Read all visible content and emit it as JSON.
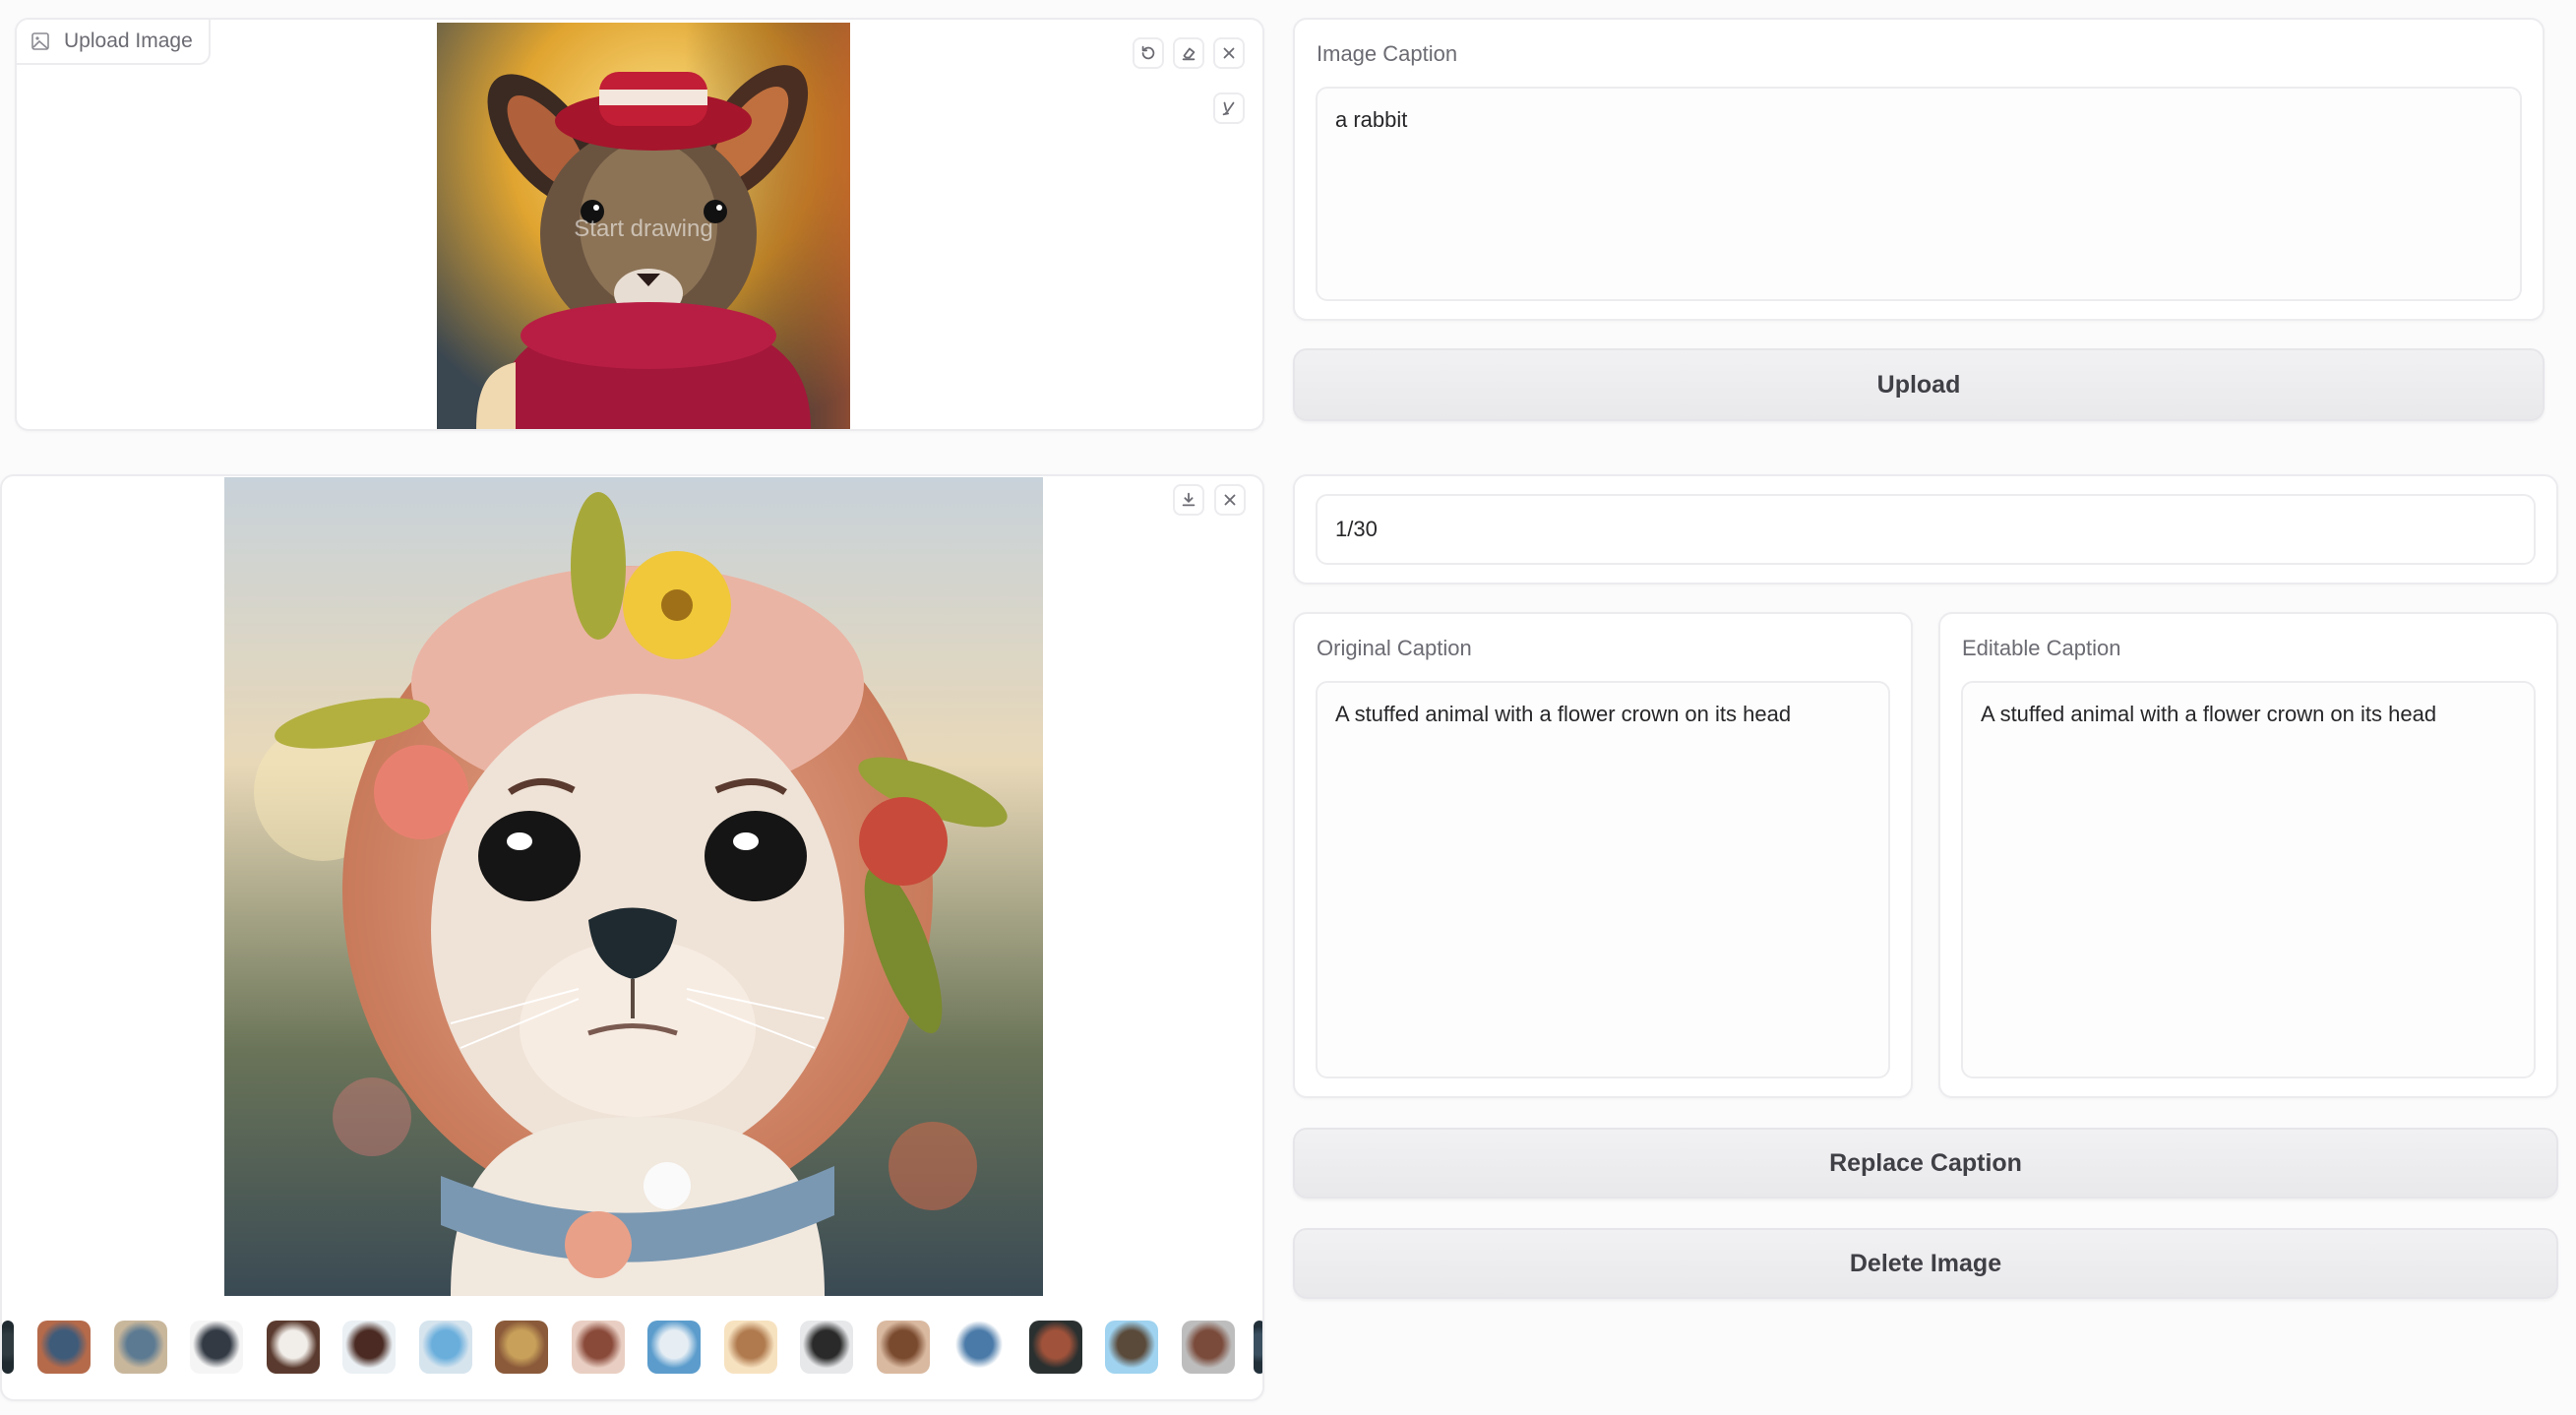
{
  "upload_panel": {
    "label": "Upload Image",
    "label_icon": "image-icon",
    "canvas_hint": "Start drawing",
    "tools": [
      "undo-icon",
      "eraser-icon",
      "close-icon",
      "brush-icon"
    ]
  },
  "gallery_panel": {
    "tools": [
      "download-icon",
      "close-icon"
    ],
    "thumbnails": [
      {
        "name": "partial-left",
        "colors": [
          "#1f2a30",
          "#2e3a40"
        ]
      },
      {
        "name": "girl-room",
        "colors": [
          "#b56a4a",
          "#3e5b7a"
        ]
      },
      {
        "name": "blonde-girl",
        "colors": [
          "#c9b79c",
          "#5c7a92"
        ]
      },
      {
        "name": "cartoon-wizard",
        "colors": [
          "#f5f5f5",
          "#333a44"
        ]
      },
      {
        "name": "santa-creature",
        "colors": [
          "#5a3a2e",
          "#f1ede8"
        ]
      },
      {
        "name": "dark-hair-kid",
        "colors": [
          "#eaf0f4",
          "#4a2a22"
        ]
      },
      {
        "name": "blue-device",
        "colors": [
          "#d6e4ee",
          "#6aaedc"
        ]
      },
      {
        "name": "hooded-girl",
        "colors": [
          "#8a5a3a",
          "#c9a05a"
        ]
      },
      {
        "name": "pink-cat",
        "colors": [
          "#e9cfc3",
          "#8a4a3a"
        ]
      },
      {
        "name": "coffee-maker",
        "colors": [
          "#5b9ccc",
          "#e6eef4"
        ]
      },
      {
        "name": "hamster",
        "colors": [
          "#f7e2c0",
          "#b07a4e"
        ]
      },
      {
        "name": "cowboy",
        "colors": [
          "#e6e8ea",
          "#2a2a2a"
        ]
      },
      {
        "name": "curly-doll",
        "colors": [
          "#d9b9a0",
          "#7a4a2e"
        ]
      },
      {
        "name": "blue-bird",
        "colors": [
          "#ffffff",
          "#4a7aa8"
        ]
      },
      {
        "name": "dark-creature",
        "colors": [
          "#2a3030",
          "#a0523a"
        ]
      },
      {
        "name": "french-press",
        "colors": [
          "#9fd3f0",
          "#5a4a3a"
        ]
      },
      {
        "name": "knit-doll",
        "colors": [
          "#bdbdbd",
          "#7a4a3a"
        ]
      },
      {
        "name": "partial-right",
        "colors": [
          "#22303a",
          "#3a5060"
        ]
      }
    ]
  },
  "caption_block": {
    "label": "Image Caption",
    "value": "a rabbit"
  },
  "upload_button": "Upload",
  "counter": {
    "value": "1/30",
    "current": 1,
    "total": 30
  },
  "original_caption": {
    "label": "Original Caption",
    "value": "A stuffed animal with a flower crown on its head"
  },
  "editable_caption": {
    "label": "Editable Caption",
    "value": "A stuffed animal with a flower crown on its head"
  },
  "replace_button": "Replace Caption",
  "delete_button": "Delete Image"
}
